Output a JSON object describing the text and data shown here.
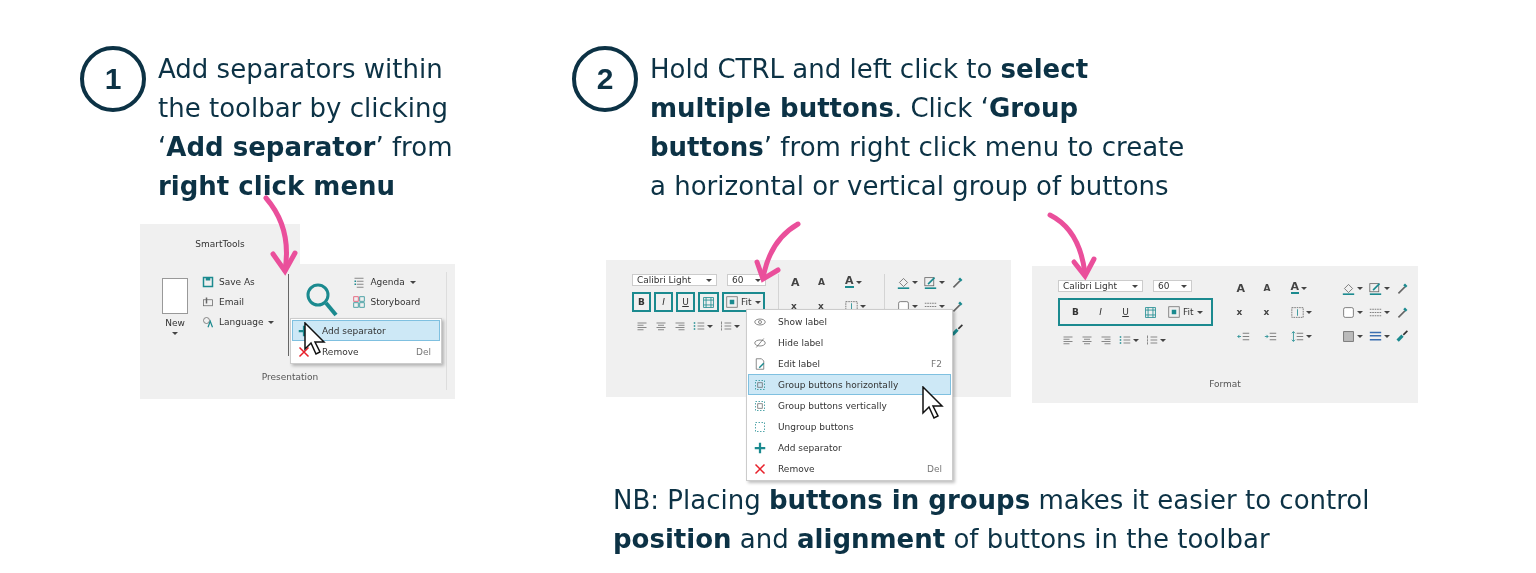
{
  "steps": [
    {
      "number": "1",
      "text": "Add separators within the toolbar by clicking ‘**Add separator**’ from **right click menu**"
    },
    {
      "number": "2",
      "text": "Hold CTRL and left click to **select multiple buttons**. Click ‘**Group buttons**’ from right click menu to create a horizontal or vertical group of buttons"
    }
  ],
  "screenshot_1": {
    "tab": "SmartTools",
    "new_button": "New",
    "buttons": [
      {
        "kind": "save",
        "label": "Save As"
      },
      {
        "kind": "email",
        "label": "Email"
      },
      {
        "kind": "language",
        "label": "Language",
        "dropdown": true
      }
    ],
    "right_buttons": [
      {
        "kind": "agenda",
        "label": "Agenda",
        "dropdown": true
      },
      {
        "kind": "storyboard",
        "label": "Storyboard"
      }
    ],
    "group_label": "Presentation",
    "context_menu": [
      {
        "kind": "plus",
        "label": "Add separator",
        "selected": true
      },
      {
        "kind": "cross",
        "label": "Remove",
        "shortcut": "Del",
        "selected": false
      }
    ]
  },
  "screenshot_2": {
    "font": "Calibri Light",
    "size": "60",
    "grouped": false,
    "format_buttons": [
      {
        "kind": "bold",
        "label": "B"
      },
      {
        "kind": "italic",
        "label": "I"
      },
      {
        "kind": "underline",
        "label": "U"
      },
      {
        "kind": "borders"
      },
      {
        "kind": "fit",
        "label": "Fit",
        "dropdown": true
      }
    ],
    "paragraph_tools": [
      {
        "kind": "align-left"
      },
      {
        "kind": "align-center"
      },
      {
        "kind": "align-right"
      },
      {
        "kind": "bullets",
        "dropdown": true
      },
      {
        "kind": "numbering",
        "dropdown": true
      }
    ],
    "tool_columns": [
      {
        "rows": [
          [
            {
              "kind": "grow",
              "glyph": "A"
            },
            {
              "kind": "shrink",
              "glyph": "A"
            },
            {
              "kind": "font-color",
              "glyph": "A",
              "dropdown": true
            }
          ],
          [
            {
              "kind": "sub",
              "glyph": "x"
            },
            {
              "kind": "sup",
              "glyph": "x"
            },
            {
              "kind": "text-spacing",
              "dropdown": true
            }
          ]
        ]
      },
      {
        "rows": [
          [
            {
              "kind": "fill",
              "dropdown": true
            },
            {
              "kind": "pen",
              "dropdown": true
            },
            {
              "kind": "dropper"
            }
          ],
          [
            {
              "kind": "box",
              "dropdown": true
            },
            {
              "kind": "dashes",
              "dropdown": true
            },
            {
              "kind": "dropper"
            }
          ],
          [
            {
              "kind": "brush"
            }
          ]
        ]
      }
    ],
    "context_menu": [
      {
        "kind": "eye",
        "label": "Show label",
        "selected": false
      },
      {
        "kind": "eye-off",
        "label": "Hide label",
        "selected": false
      },
      {
        "kind": "edit",
        "label": "Edit label",
        "shortcut": "F2",
        "selected": false
      },
      {
        "kind": "group-h",
        "label": "Group buttons horizontally",
        "selected": true
      },
      {
        "kind": "group-v",
        "label": "Group buttons vertically",
        "selected": false
      },
      {
        "kind": "ungroup",
        "label": "Ungroup buttons",
        "selected": false
      },
      {
        "kind": "plus",
        "label": "Add separator",
        "selected": false
      },
      {
        "kind": "cross",
        "label": "Remove",
        "shortcut": "Del",
        "selected": false
      }
    ]
  },
  "screenshot_3": {
    "font": "Calibri Light",
    "size": "60",
    "grouped": true,
    "format_buttons": [
      {
        "kind": "bold",
        "label": "B"
      },
      {
        "kind": "italic",
        "label": "I"
      },
      {
        "kind": "underline",
        "label": "U"
      },
      {
        "kind": "borders"
      },
      {
        "kind": "fit",
        "label": "Fit",
        "dropdown": true
      }
    ],
    "paragraph_tools": [
      {
        "kind": "align-left"
      },
      {
        "kind": "align-center"
      },
      {
        "kind": "align-right"
      },
      {
        "kind": "bullets",
        "dropdown": true
      },
      {
        "kind": "numbering",
        "dropdown": true
      }
    ],
    "tool_columns": [
      {
        "rows": [
          [
            {
              "kind": "grow",
              "glyph": "A"
            },
            {
              "kind": "shrink",
              "glyph": "A"
            },
            {
              "kind": "font-color",
              "glyph": "A",
              "dropdown": true
            }
          ],
          [
            {
              "kind": "sub",
              "glyph": "x"
            },
            {
              "kind": "sup",
              "glyph": "x"
            },
            {
              "kind": "text-spacing",
              "dropdown": true
            }
          ],
          [
            {
              "kind": "indent-dec"
            },
            {
              "kind": "indent-inc"
            },
            {
              "kind": "line-spacing",
              "dropdown": true
            }
          ]
        ]
      },
      {
        "rows": [
          [
            {
              "kind": "fill",
              "dropdown": true
            },
            {
              "kind": "pen",
              "dropdown": true
            },
            {
              "kind": "dropper"
            }
          ],
          [
            {
              "kind": "box",
              "dropdown": true
            },
            {
              "kind": "dashes",
              "dropdown": true
            },
            {
              "kind": "dropper"
            }
          ],
          [
            {
              "kind": "gradient",
              "dropdown": true
            },
            {
              "kind": "lines",
              "dropdown": true
            },
            {
              "kind": "brush"
            }
          ]
        ]
      }
    ],
    "group_label": "Format"
  },
  "note": "NB: Placing **buttons in groups** makes it easier to control **position** and **alignment** of buttons in the toolbar"
}
